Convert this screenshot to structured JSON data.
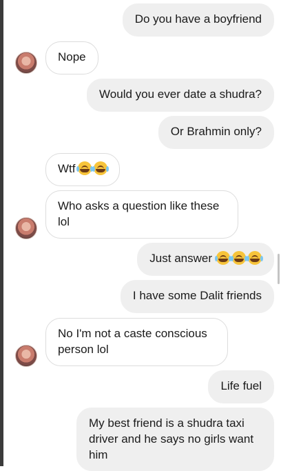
{
  "messages": [
    {
      "from": "me",
      "text": "Do you have a boyfriend"
    },
    {
      "from": "them",
      "text": "Nope"
    },
    {
      "from": "me",
      "text": "Would you ever date a shudra?"
    },
    {
      "from": "me",
      "text": "Or Brahmin only?"
    },
    {
      "from": "them",
      "text": "Wtf"
    },
    {
      "from": "them",
      "text": "Who asks a question like these lol"
    },
    {
      "from": "me",
      "text": "Just answer"
    },
    {
      "from": "me",
      "text": "I have some Dalit friends"
    },
    {
      "from": "them",
      "text": "No I'm not a caste conscious person lol"
    },
    {
      "from": "me",
      "text": "Life fuel"
    },
    {
      "from": "me",
      "text": "My best friend is a shudra taxi driver and he says no girls want him"
    }
  ],
  "icons": {
    "emoji": "face-with-tears-of-joy-icon",
    "avatar": "contact-avatar"
  },
  "colors": {
    "outgoing_bubble": "#efefef",
    "incoming_border": "#dcdcdc",
    "emoji": "#f7c43b"
  }
}
